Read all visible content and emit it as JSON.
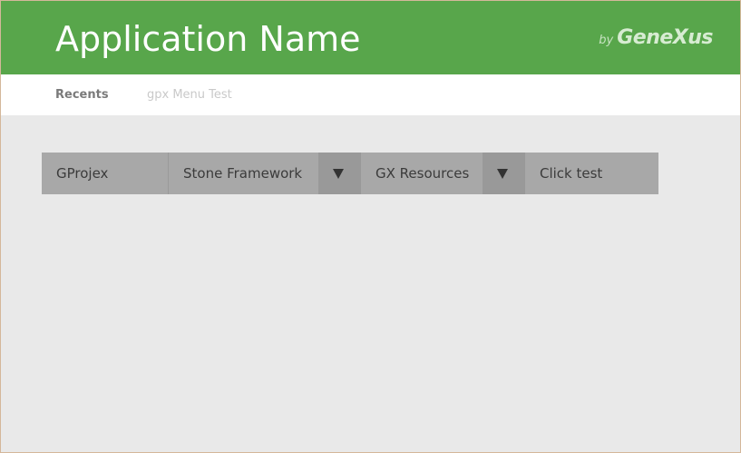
{
  "header": {
    "title": "Application Name",
    "brand_by": "by",
    "brand_name": "GeneXus",
    "color": "#58a64b"
  },
  "tabs": [
    {
      "label": "Recents",
      "active": true
    },
    {
      "label": "gpx Menu Test",
      "active": false
    }
  ],
  "menu": {
    "items": [
      {
        "label": "GProjex",
        "has_dropdown": false
      },
      {
        "label": "Stone Framework",
        "has_dropdown": true
      },
      {
        "label": "GX Resources",
        "has_dropdown": true
      },
      {
        "label": "Click test",
        "has_dropdown": false
      }
    ],
    "dropdown_icon": "caret-down-icon"
  }
}
